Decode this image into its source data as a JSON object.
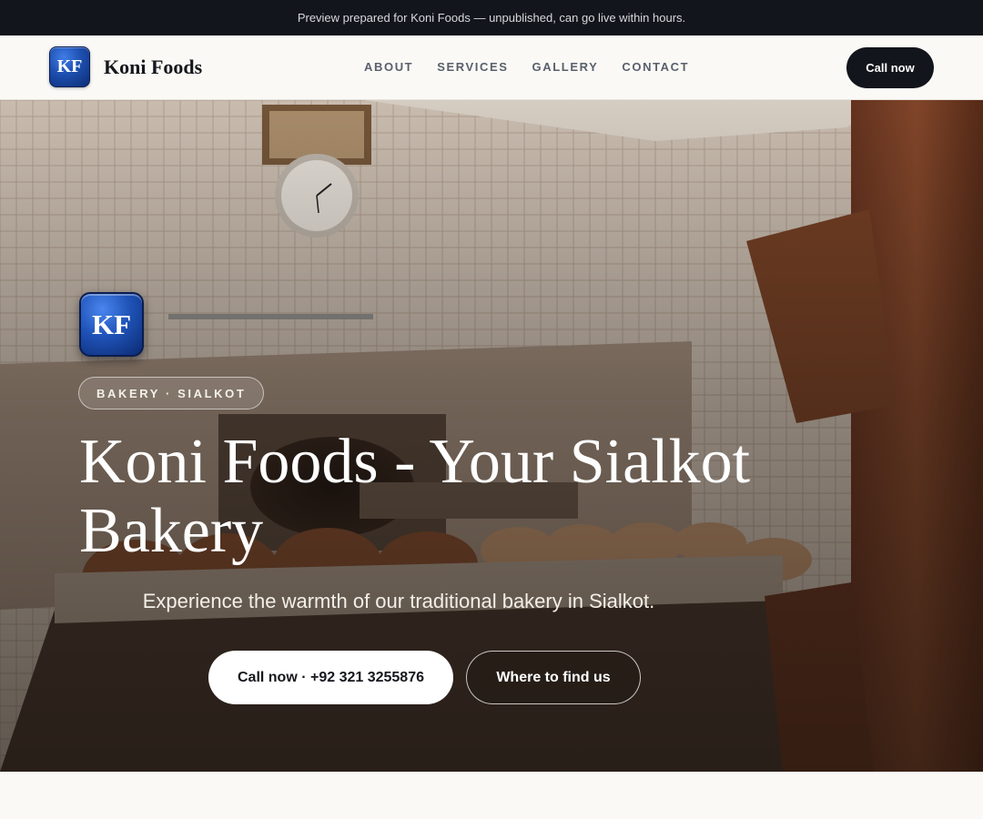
{
  "announcement": "Preview prepared for Koni Foods — unpublished, can go live within hours.",
  "header": {
    "logo_initials": "KF",
    "brand_name": "Koni Foods",
    "nav": [
      "ABOUT",
      "SERVICES",
      "GALLERY",
      "CONTACT"
    ],
    "cta_label": "Call now"
  },
  "hero": {
    "logo_initials": "KF",
    "tag": "BAKERY · SIALKOT",
    "title": "Koni Foods - Your Sialkot Bakery",
    "subtitle": "Experience the warmth of our traditional bakery in Sialkot.",
    "primary_button": "Call now · +92 321 3255876",
    "secondary_button": "Where to find us",
    "background_image": "bakery-kitchen-photo"
  },
  "colors": {
    "dark": "#12151b",
    "accent_blue": "#1d4fb0",
    "page_bg": "#faf9f6"
  }
}
